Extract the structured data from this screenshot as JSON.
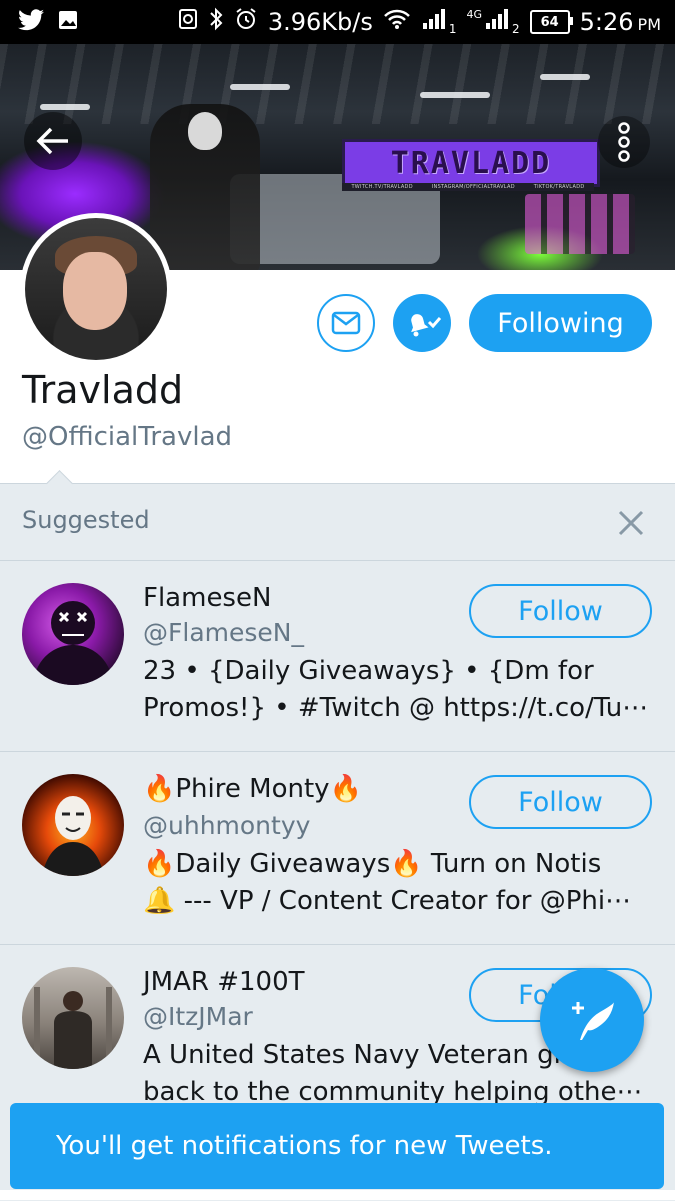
{
  "status_bar": {
    "network_speed": "3.96Kb/s",
    "sim1": "1",
    "sim2_type": "4G",
    "sim2": "2",
    "battery": "64",
    "time": "5:26",
    "ampm": "PM"
  },
  "banner": {
    "logo_text": "TRAVLADD",
    "social_line": [
      "TWITCH.TV/TRAVLADD",
      "INSTAGRAM/OFFICIALTRAVLAD",
      "TIKTOK/TRAVLADD"
    ]
  },
  "profile": {
    "display_name": "Travladd",
    "handle": "@OfficialTravlad",
    "following_label": "Following"
  },
  "suggested": {
    "header": "Suggested",
    "items": [
      {
        "name": "FlameseN",
        "handle": "@FlameseN_",
        "bio": "23 • {Daily Giveaways} • {Dm for\nPromos!} • #Twitch @ https://t.co/Tu⋯",
        "follow_label": "Follow"
      },
      {
        "name": "🔥Phire Monty🔥",
        "handle": "@uhhmontyy",
        "bio": "🔥Daily Giveaways🔥 Turn on Notis\n🔔 --- VP / Content Creator for @Phi⋯",
        "follow_label": "Follow"
      },
      {
        "name": "JMAR #100T",
        "handle": "@ItzJMar",
        "bio": "A United States Navy Veteran giving\nback to the community helping othe⋯",
        "follow_label": "Follow"
      }
    ]
  },
  "toast": {
    "message": "You'll get notifications for new Tweets."
  },
  "colors": {
    "accent": "#1da1f2",
    "suggested_bg": "#e6ecf0",
    "secondary_text": "#657786"
  }
}
